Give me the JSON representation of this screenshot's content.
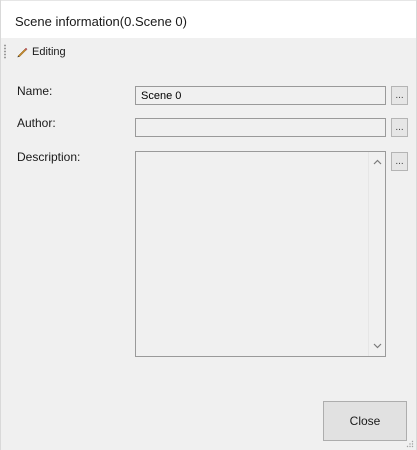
{
  "window": {
    "title": "Scene information(0.Scene 0)"
  },
  "toolbar": {
    "editing_label": "Editing",
    "editing_icon": "pencil-icon"
  },
  "form": {
    "name": {
      "label": "Name:",
      "value": "Scene 0",
      "button_label": "..."
    },
    "author": {
      "label": "Author:",
      "value": "",
      "button_label": "..."
    },
    "description": {
      "label": "Description:",
      "value": "",
      "button_label": "..."
    }
  },
  "footer": {
    "close_label": "Close"
  },
  "colors": {
    "panel_bg": "#f0f0f0",
    "field_border": "#9a9a9a",
    "button_bg": "#e1e1e1",
    "pencil_body": "#c48a2c",
    "pencil_tip": "#3a3a3a"
  }
}
